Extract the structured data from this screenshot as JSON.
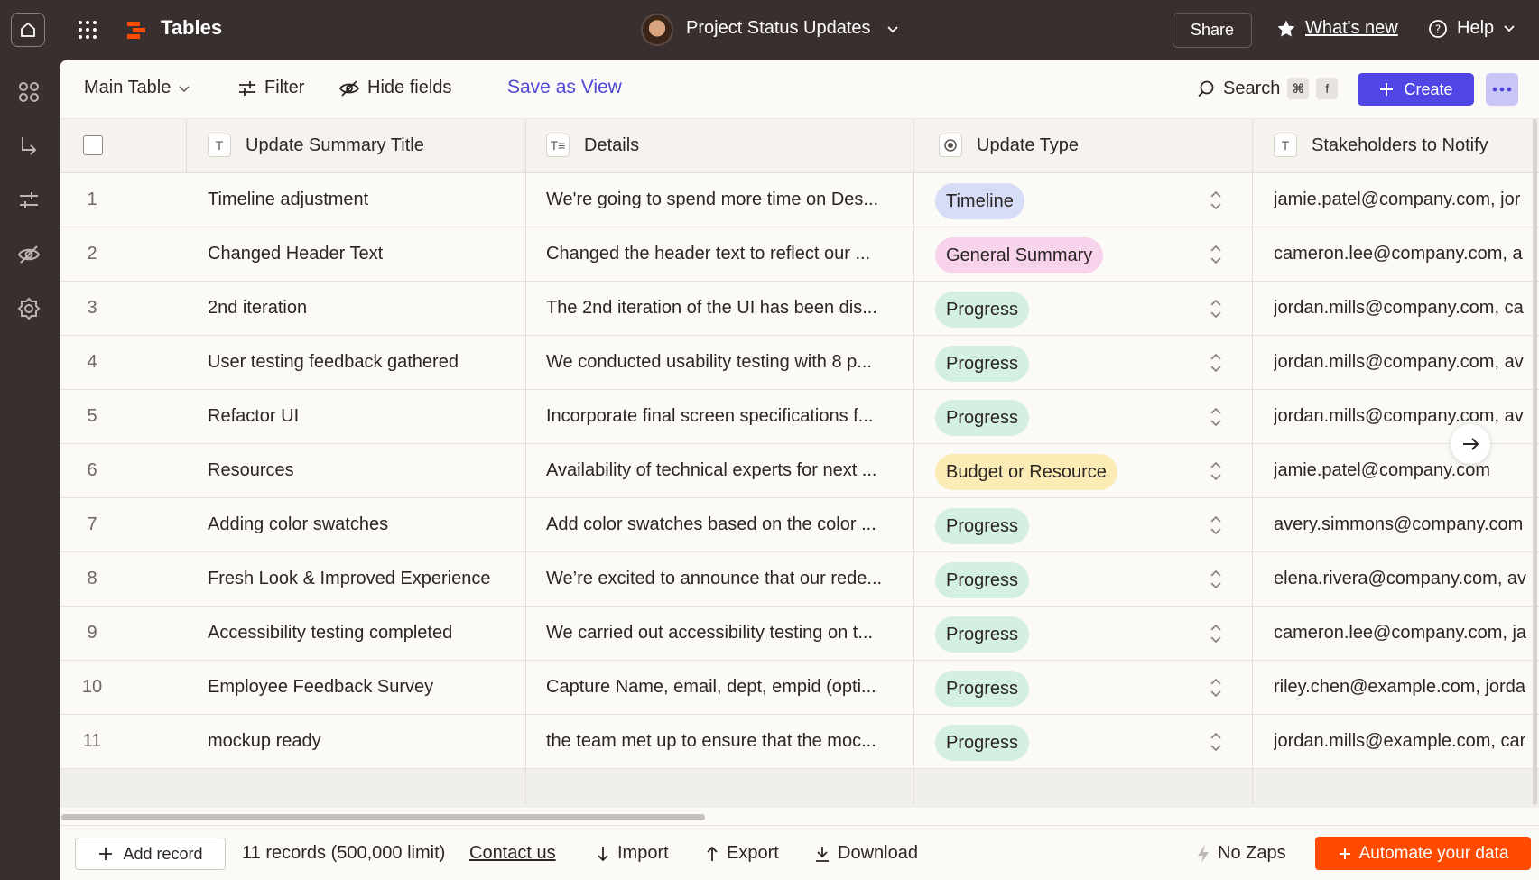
{
  "topbar": {
    "app_title": "Tables",
    "project_title": "Project Status Updates",
    "share_label": "Share",
    "whats_new_label": "What's new",
    "help_label": "Help"
  },
  "toolbar": {
    "view_label": "Main Table",
    "filter_label": "Filter",
    "hide_fields_label": "Hide fields",
    "save_view_label": "Save as View",
    "search_label": "Search",
    "search_shortcut_key1": "⌘",
    "search_shortcut_key2": "f",
    "create_label": "Create"
  },
  "columns": [
    {
      "label": "Update Summary Title",
      "type_icon": "T"
    },
    {
      "label": "Details",
      "type_icon": "T≡"
    },
    {
      "label": "Update Type",
      "type_icon": "radio"
    },
    {
      "label": "Stakeholders to Notify",
      "type_icon": "T"
    }
  ],
  "rows": [
    {
      "num": "1",
      "title": "Timeline adjustment",
      "details": "We're going to spend more time on Des...",
      "type": "Timeline",
      "email": "jamie.patel@company.com, jor"
    },
    {
      "num": "2",
      "title": "Changed Header Text",
      "details": "Changed the header text to reflect our ...",
      "type": "General Summary",
      "email": "cameron.lee@company.com, a"
    },
    {
      "num": "3",
      "title": "2nd iteration",
      "details": "The 2nd iteration of the UI has been dis...",
      "type": "Progress",
      "email": "jordan.mills@company.com, ca"
    },
    {
      "num": "4",
      "title": "User testing feedback gathered",
      "details": "We conducted usability testing with 8 p...",
      "type": "Progress",
      "email": "jordan.mills@company.com, av"
    },
    {
      "num": "5",
      "title": "Refactor UI",
      "details": "Incorporate final screen specifications f...",
      "type": "Progress",
      "email": "jordan.mills@company.com, av"
    },
    {
      "num": "6",
      "title": "Resources",
      "details": "Availability of technical experts for next ...",
      "type": "Budget or Resource",
      "email": "jamie.patel@company.com"
    },
    {
      "num": "7",
      "title": "Adding color swatches",
      "details": "Add color swatches based on the color ...",
      "type": "Progress",
      "email": "avery.simmons@company.com"
    },
    {
      "num": "8",
      "title": "Fresh Look & Improved Experience",
      "details": "We’re excited to announce that our rede...",
      "type": "Progress",
      "email": "elena.rivera@company.com, av"
    },
    {
      "num": "9",
      "title": "Accessibility testing completed",
      "details": "We carried out accessibility testing on t...",
      "type": "Progress",
      "email": "cameron.lee@company.com, ja"
    },
    {
      "num": "10",
      "title": "Employee Feedback Survey",
      "details": "Capture Name, email, dept, empid (opti...",
      "type": "Progress",
      "email": "riley.chen@example.com, jorda"
    },
    {
      "num": "11",
      "title": "mockup ready",
      "details": "the team met up to ensure that the moc...",
      "type": "Progress",
      "email": "jordan.mills@example.com, car"
    }
  ],
  "type_colors": {
    "Timeline": "#d7dcf7",
    "General Summary": "#f7d3ec",
    "Progress": "#d3f0e2",
    "Budget or Resource": "#fbecb5"
  },
  "footer": {
    "add_record_label": "Add record",
    "records_count": "11 records (500,000 limit)",
    "contact_label": "Contact us",
    "import_label": "Import",
    "export_label": "Export",
    "download_label": "Download",
    "no_zaps_label": "No Zaps",
    "automate_label": "Automate your data"
  },
  "colors": {
    "accent": "#5046e5",
    "brand_orange": "#ff4a00",
    "chrome": "#3a2f2f"
  }
}
